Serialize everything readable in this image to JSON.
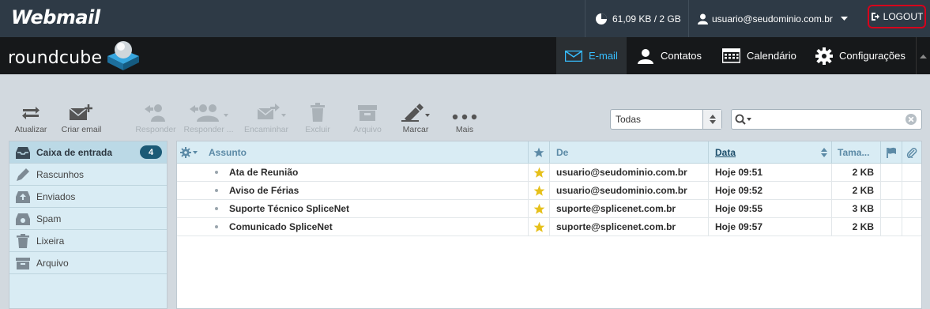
{
  "topbar": {
    "brand": "Webmail",
    "quota": "61,09 KB / 2 GB",
    "user": "usuario@seudominio.com.br",
    "logout": "LOGOUT",
    "logout_highlight_color": "#d6001c"
  },
  "header": {
    "logo_text": "roundcube",
    "nav": [
      {
        "label": "E-mail",
        "icon": "envelope-icon",
        "active": true
      },
      {
        "label": "Contatos",
        "icon": "person-icon"
      },
      {
        "label": "Calendário",
        "icon": "calendar-icon"
      },
      {
        "label": "Configurações",
        "icon": "gear-icon"
      }
    ],
    "accent_color": "#37beff"
  },
  "toolbar": {
    "atualizar": "Atualizar",
    "criar": "Criar email",
    "responder": "Responder",
    "responder_todos": "Responder ...",
    "encaminhar": "Encaminhar",
    "excluir": "Excluir",
    "arquivo": "Arquivo",
    "marcar": "Marcar",
    "mais": "Mais"
  },
  "search": {
    "filter_value": "Todas",
    "placeholder": ""
  },
  "folders": [
    {
      "name": "Caixa de entrada",
      "icon": "inbox-icon",
      "unread": "4",
      "selected": true
    },
    {
      "name": "Rascunhos",
      "icon": "pencil-icon"
    },
    {
      "name": "Enviados",
      "icon": "sent-icon"
    },
    {
      "name": "Spam",
      "icon": "spam-icon"
    },
    {
      "name": "Lixeira",
      "icon": "trash-icon"
    },
    {
      "name": "Arquivo",
      "icon": "archive-icon"
    }
  ],
  "list": {
    "headers": {
      "subject": "Assunto",
      "from": "De",
      "date": "Data",
      "size": "Tama..."
    },
    "messages": [
      {
        "subject": "Ata de Reunião",
        "from": "usuario@seudominio.com.br",
        "date": "Hoje 09:51",
        "size": "2 KB",
        "flagged": true
      },
      {
        "subject": "Aviso de Férias",
        "from": "usuario@seudominio.com.br",
        "date": "Hoje 09:52",
        "size": "2 KB",
        "flagged": true
      },
      {
        "subject": "Suporte Técnico SpliceNet",
        "from": "suporte@splicenet.com.br",
        "date": "Hoje 09:55",
        "size": "3 KB",
        "flagged": true
      },
      {
        "subject": "Comunicado SpliceNet",
        "from": "suporte@splicenet.com.br",
        "date": "Hoje 09:57",
        "size": "2 KB",
        "flagged": true
      }
    ]
  }
}
